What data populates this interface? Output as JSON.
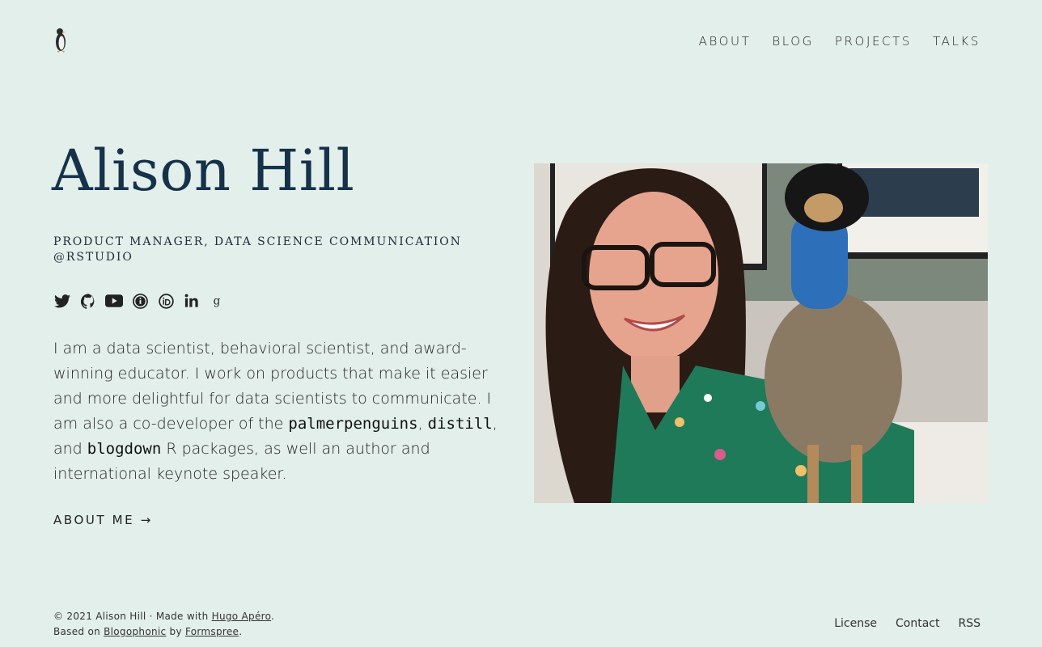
{
  "nav": {
    "items": [
      {
        "label": "ABOUT"
      },
      {
        "label": "BLOG"
      },
      {
        "label": "PROJECTS"
      },
      {
        "label": "TALKS"
      }
    ]
  },
  "hero": {
    "name": "Alison Hill",
    "subtitle_line1": "PRODUCT MANAGER, DATA SCIENCE COMMUNICATION",
    "subtitle_line2": "@RSTUDIO",
    "social_icons": [
      "twitter-icon",
      "github-icon",
      "youtube-icon",
      "info-icon",
      "orcid-icon",
      "linkedin-icon",
      "google-scholar-icon"
    ],
    "bio_part1": "I am a data scientist, behavioral scientist, and award-winning educator. I work on products that make it easier and more delightful for data scientists to communicate. I am also a co-developer of the ",
    "pkg1": "palmerpenguins",
    "sep1": ", ",
    "pkg2": "distill",
    "sep2": ", and ",
    "pkg3": "blogdown",
    "bio_part2": " R packages, as well an author and international keynote speaker.",
    "about_link": "ABOUT ME →"
  },
  "footer": {
    "copyright": "© 2021 Alison Hill",
    "dot": " · ",
    "made_with": "Made with ",
    "hugo_link": "Hugo Apéro",
    "period1": ".",
    "based_on": "Based on ",
    "blogophonic_link": "Blogophonic",
    "by": " by ",
    "formspree_link": "Formspree",
    "period2": ".",
    "links": [
      {
        "label": "License"
      },
      {
        "label": "Contact"
      },
      {
        "label": "RSS"
      }
    ]
  },
  "colors": {
    "background": "#e3efeb",
    "title": "#16324a",
    "text": "#222222"
  }
}
